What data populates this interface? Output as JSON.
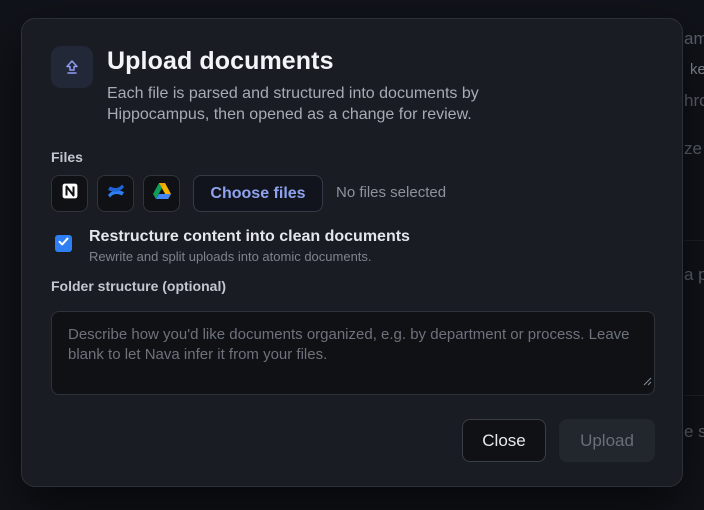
{
  "background": {
    "fragments": [
      "am",
      "ke",
      "hro",
      "ze",
      "a p",
      "e s"
    ]
  },
  "modal": {
    "icon": "upload-icon",
    "title": "Upload documents",
    "description": "Each file is parsed and structured into documents by Hippocampus, then opened as a change for review.",
    "files_label": "Files",
    "sources": [
      {
        "name": "notion-icon"
      },
      {
        "name": "confluence-icon"
      },
      {
        "name": "google-drive-icon"
      }
    ],
    "choose_files_label": "Choose files",
    "file_status": "No files selected",
    "restructure": {
      "checked": true,
      "label": "Restructure content into clean documents",
      "sublabel": "Rewrite and split uploads into atomic documents."
    },
    "folder_label": "Folder structure (optional)",
    "folder_placeholder": "Describe how you'd like documents organized, e.g. by department or process. Leave blank to let Nava infer it from your files.",
    "close_label": "Close",
    "upload_label": "Upload",
    "upload_enabled": false
  },
  "colors": {
    "accent": "#8ea2ee",
    "checkbox": "#2f7ff4",
    "modal_bg": "#191c22"
  }
}
